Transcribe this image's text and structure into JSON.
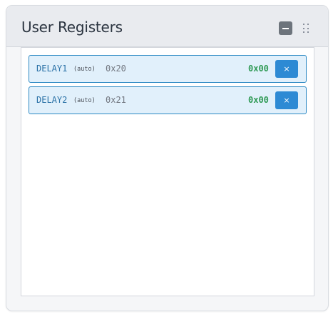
{
  "panel": {
    "title": "User Registers",
    "collapse_icon": "minus-icon",
    "drag_icon": "grip-dots-icon"
  },
  "registers": [
    {
      "name": "DELAY1",
      "mode": "(auto)",
      "address": "0x20",
      "value": "0x00",
      "remove_label": "×"
    },
    {
      "name": "DELAY2",
      "mode": "(auto)",
      "address": "0x21",
      "value": "0x00",
      "remove_label": "×"
    }
  ],
  "colors": {
    "accent": "#2d8ad4",
    "row_bg": "#e1f0fb",
    "row_border": "#2d8ac4",
    "value": "#2f9a55",
    "name": "#2b72a7"
  }
}
